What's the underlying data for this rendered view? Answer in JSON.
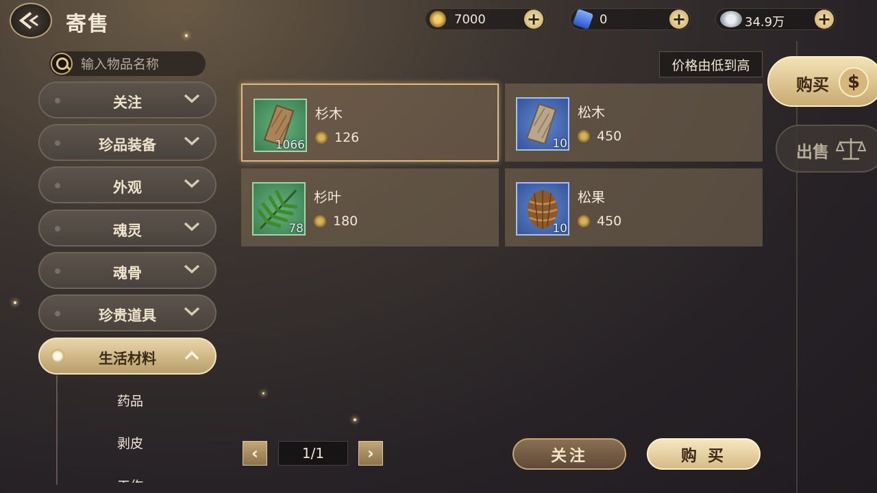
{
  "header": {
    "back_icon": "back-arrow-icon",
    "title": "寄售"
  },
  "currencies": [
    {
      "name": "gold-coin-icon",
      "value": "7000"
    },
    {
      "name": "blue-crystal-icon",
      "value": "0"
    },
    {
      "name": "silver-coins-icon",
      "value": "34.9万"
    }
  ],
  "search": {
    "placeholder": "输入物品名称"
  },
  "sidebar": {
    "categories": [
      {
        "label": "关注"
      },
      {
        "label": "珍品装备"
      },
      {
        "label": "外观"
      },
      {
        "label": "魂灵"
      },
      {
        "label": "魂骨"
      },
      {
        "label": "珍贵道具"
      },
      {
        "label": "生活材料",
        "active": true
      }
    ],
    "subitems": [
      {
        "label": "药品"
      },
      {
        "label": "剥皮"
      },
      {
        "label": "工作"
      }
    ]
  },
  "sort": {
    "label": "价格由低到高"
  },
  "items": [
    {
      "name": "杉木",
      "qty": "1066",
      "price": "126",
      "icon": "wood-plank-icon",
      "bg": "green"
    },
    {
      "name": "松木",
      "qty": "10",
      "price": "450",
      "icon": "wood-plank-icon",
      "bg": "blue"
    },
    {
      "name": "杉叶",
      "qty": "78",
      "price": "180",
      "icon": "fir-leaves-icon",
      "bg": "green"
    },
    {
      "name": "松果",
      "qty": "10",
      "price": "450",
      "icon": "pinecone-icon",
      "bg": "blue"
    }
  ],
  "tabs": {
    "buy": {
      "label": "购买",
      "icon": "money-bag-icon"
    },
    "sell": {
      "label": "出售",
      "icon": "scale-icon"
    }
  },
  "pager": {
    "page": "1/1"
  },
  "buttons": {
    "follow": "关注",
    "buy": "购 买"
  },
  "colors": {
    "accent": "#e0c99a",
    "active_tab": "#f3e2b6"
  }
}
